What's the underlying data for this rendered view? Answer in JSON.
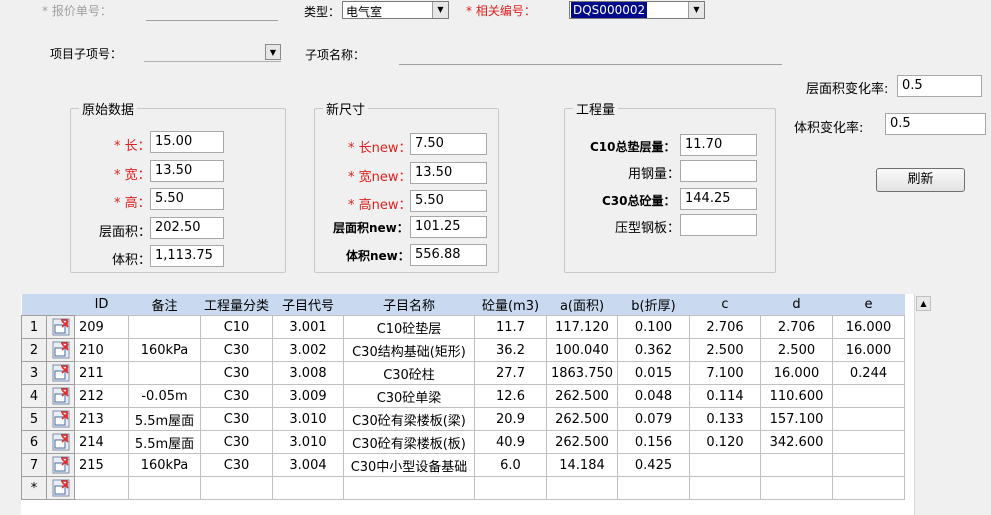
{
  "header": {
    "quote_no_label": "* 报价单号：",
    "type_label": "类型：",
    "type_value": "电气室",
    "related_no_label": "* 相关编号：",
    "related_no_value": "DQS000002",
    "subitem_no_label": "项目子项号：",
    "subitem_name_label": "子项名称："
  },
  "rates": {
    "area_rate_label": "层面积变化率:",
    "area_rate_value": "0.5",
    "volume_rate_label": "体积变化率:",
    "volume_rate_value": "0.5",
    "refresh_label": "刷新"
  },
  "original": {
    "title": "原始数据",
    "length_label": "* 长：",
    "length_value": "15.00",
    "width_label": "* 宽：",
    "width_value": "13.50",
    "height_label": "* 高：",
    "height_value": "5.50",
    "area_label": "层面积：",
    "area_value": "202.50",
    "volume_label": "体积：",
    "volume_value": "1,113.75"
  },
  "new_size": {
    "title": "新尺寸",
    "length_label": "* 长new：",
    "length_value": "7.50",
    "width_label": "* 宽new：",
    "width_value": "13.50",
    "height_label": "* 高new：",
    "height_value": "5.50",
    "area_label": "层面积new：",
    "area_value": "101.25",
    "volume_label": "体积new：",
    "volume_value": "556.88"
  },
  "quantities": {
    "title": "工程量",
    "c10_label": "C10总垫层量：",
    "c10_value": "11.70",
    "steel_label": "用钢量：",
    "steel_value": "",
    "c30_label": "C30总砼量：",
    "c30_value": "144.25",
    "plate_label": "压型钢板：",
    "plate_value": ""
  },
  "grid": {
    "columns": [
      "ID",
      "备注",
      "工程量分类",
      "子目代号",
      "子目名称",
      "砼量(m3)",
      "a(面积)",
      "b(折厚)",
      "c",
      "d",
      "e"
    ],
    "rows": [
      {
        "n": "1",
        "cells": [
          "209",
          "",
          "C10",
          "3.001",
          "C10砼垫层",
          "11.7",
          "117.120",
          "0.100",
          "2.706",
          "2.706",
          "16.000"
        ]
      },
      {
        "n": "2",
        "cells": [
          "210",
          "160kPa",
          "C30",
          "3.002",
          "C30结构基础(矩形)",
          "36.2",
          "100.040",
          "0.362",
          "2.500",
          "2.500",
          "16.000"
        ]
      },
      {
        "n": "3",
        "cells": [
          "211",
          "",
          "C30",
          "3.008",
          "C30砼柱",
          "27.7",
          "1863.750",
          "0.015",
          "7.100",
          "16.000",
          "0.244"
        ]
      },
      {
        "n": "4",
        "cells": [
          "212",
          "-0.05m",
          "C30",
          "3.009",
          "C30砼单梁",
          "12.6",
          "262.500",
          "0.048",
          "0.114",
          "110.600",
          ""
        ]
      },
      {
        "n": "5",
        "cells": [
          "213",
          "5.5m屋面",
          "C30",
          "3.010",
          "C30砼有梁楼板(梁)",
          "20.9",
          "262.500",
          "0.079",
          "0.133",
          "157.100",
          ""
        ]
      },
      {
        "n": "6",
        "cells": [
          "214",
          "5.5m屋面",
          "C30",
          "3.010",
          "C30砼有梁楼板(板)",
          "40.9",
          "262.500",
          "0.156",
          "0.120",
          "342.600",
          ""
        ]
      },
      {
        "n": "7",
        "cells": [
          "215",
          "160kPa",
          "C30",
          "3.004",
          "C30中小型设备基础",
          "6.0",
          "14.184",
          "0.425",
          "",
          "",
          ""
        ]
      },
      {
        "n": "*",
        "cells": [
          "",
          "",
          "",
          "",
          "",
          "",
          "",
          "",
          "",
          "",
          ""
        ]
      }
    ]
  }
}
